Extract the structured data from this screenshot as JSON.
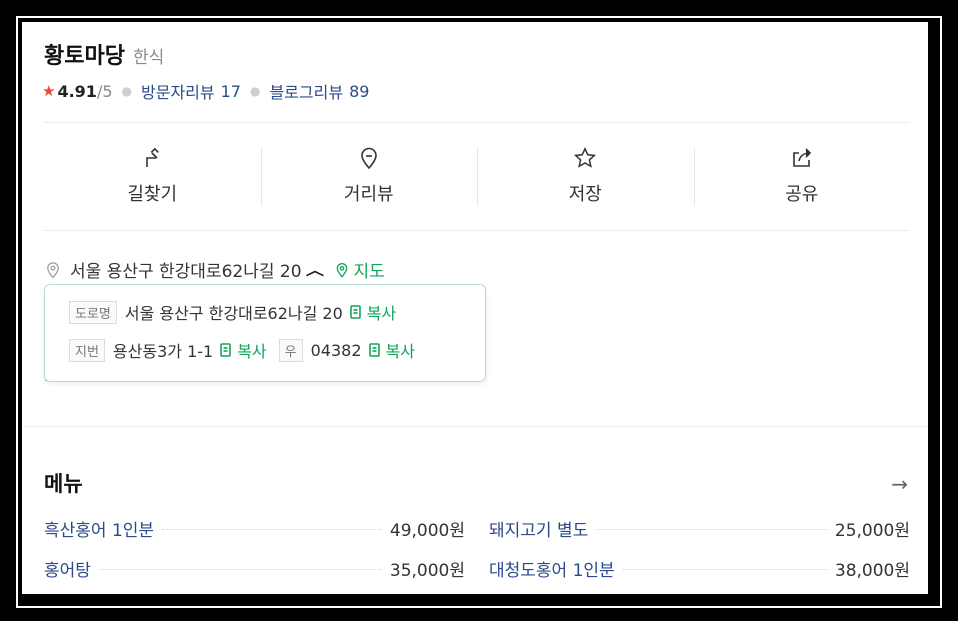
{
  "place": {
    "name": "황토마당",
    "category": "한식",
    "rating": "4.91",
    "rating_max": "/5",
    "visitor_reviews_label": "방문자리뷰",
    "visitor_reviews_count": "17",
    "blog_reviews_label": "블로그리뷰",
    "blog_reviews_count": "89"
  },
  "actions": [
    {
      "label": "길찾기",
      "icon": "directions-icon"
    },
    {
      "label": "거리뷰",
      "icon": "street-view-icon"
    },
    {
      "label": "저장",
      "icon": "star-icon"
    },
    {
      "label": "공유",
      "icon": "share-icon"
    }
  ],
  "address": {
    "text": "서울 용산구 한강대로62나길 20",
    "map_label": "지도",
    "road_tag": "도로명",
    "road_address": "서울 용산구 한강대로62나길 20",
    "jibun_tag": "지번",
    "jibun_address": "용산동3가 1-1",
    "zip_tag": "우",
    "zip": "04382",
    "copy_label": "복사"
  },
  "menu": {
    "title": "메뉴",
    "items": [
      {
        "name": "흑산홍어 1인분",
        "price": "49,000원"
      },
      {
        "name": "돼지고기 별도",
        "price": "25,000원"
      },
      {
        "name": "홍어탕",
        "price": "35,000원"
      },
      {
        "name": "대청도홍어 1인분",
        "price": "38,000원"
      }
    ]
  },
  "colors": {
    "accent_green": "#12a35a",
    "link_blue": "#2b4a8a",
    "star_red": "#e8473b"
  }
}
